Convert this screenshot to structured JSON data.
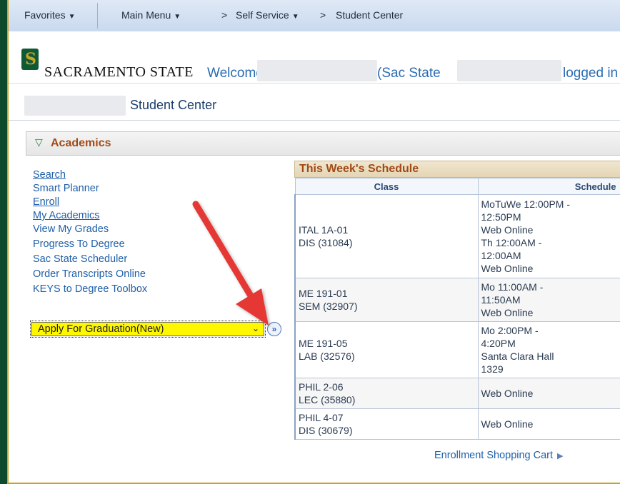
{
  "nav": {
    "favorites": "Favorites",
    "main_menu": "Main Menu",
    "sep1": ">",
    "self_service": "Self Service",
    "sep2": ">",
    "student_center": "Student Center"
  },
  "header": {
    "logo_text": "SACRAMENTO STATE",
    "welcome": "Welcome,",
    "sac_state": "(Sac State",
    "logged_in": "logged in"
  },
  "page": {
    "title": "Student Center"
  },
  "academics": {
    "label": "Academics",
    "links": [
      "Search",
      "Smart Planner",
      "Enroll",
      "My Academics",
      "View My Grades",
      "Progress To Degree",
      "Sac State Scheduler",
      "Order Transcripts Online",
      "KEYS to Degree Toolbox"
    ],
    "select_value": "Apply For Graduation(New)",
    "go_label": "»"
  },
  "schedule": {
    "title": "This Week's Schedule",
    "col_class": "Class",
    "col_schedule": "Schedule",
    "rows": [
      {
        "class": [
          "ITAL 1A-01",
          "DIS (31084)"
        ],
        "schedule": [
          "MoTuWe 12:00PM -",
          "12:50PM",
          "Web Online",
          "Th 12:00AM -",
          "12:00AM",
          "Web Online"
        ]
      },
      {
        "class": [
          "ME 191-01",
          "SEM (32907)"
        ],
        "schedule": [
          "Mo 11:00AM -",
          "11:50AM",
          "Web Online"
        ]
      },
      {
        "class": [
          "ME 191-05",
          "LAB (32576)"
        ],
        "schedule": [
          "Mo 2:00PM -",
          "4:20PM",
          "Santa Clara Hall",
          "1329"
        ]
      },
      {
        "class": [
          "PHIL 2-06",
          "LEC (35880)"
        ],
        "schedule": [
          "Web Online"
        ]
      },
      {
        "class": [
          "PHIL 4-07",
          "DIS (30679)"
        ],
        "schedule": [
          "Web Online"
        ]
      }
    ],
    "cart_link": "Enrollment Shopping Cart"
  },
  "colors": {
    "accent_orange": "#a24a17",
    "link_blue": "#1f5fa8",
    "brand_green": "#0e5a35",
    "gold": "#c9a227",
    "arrow_red": "#e53935"
  }
}
